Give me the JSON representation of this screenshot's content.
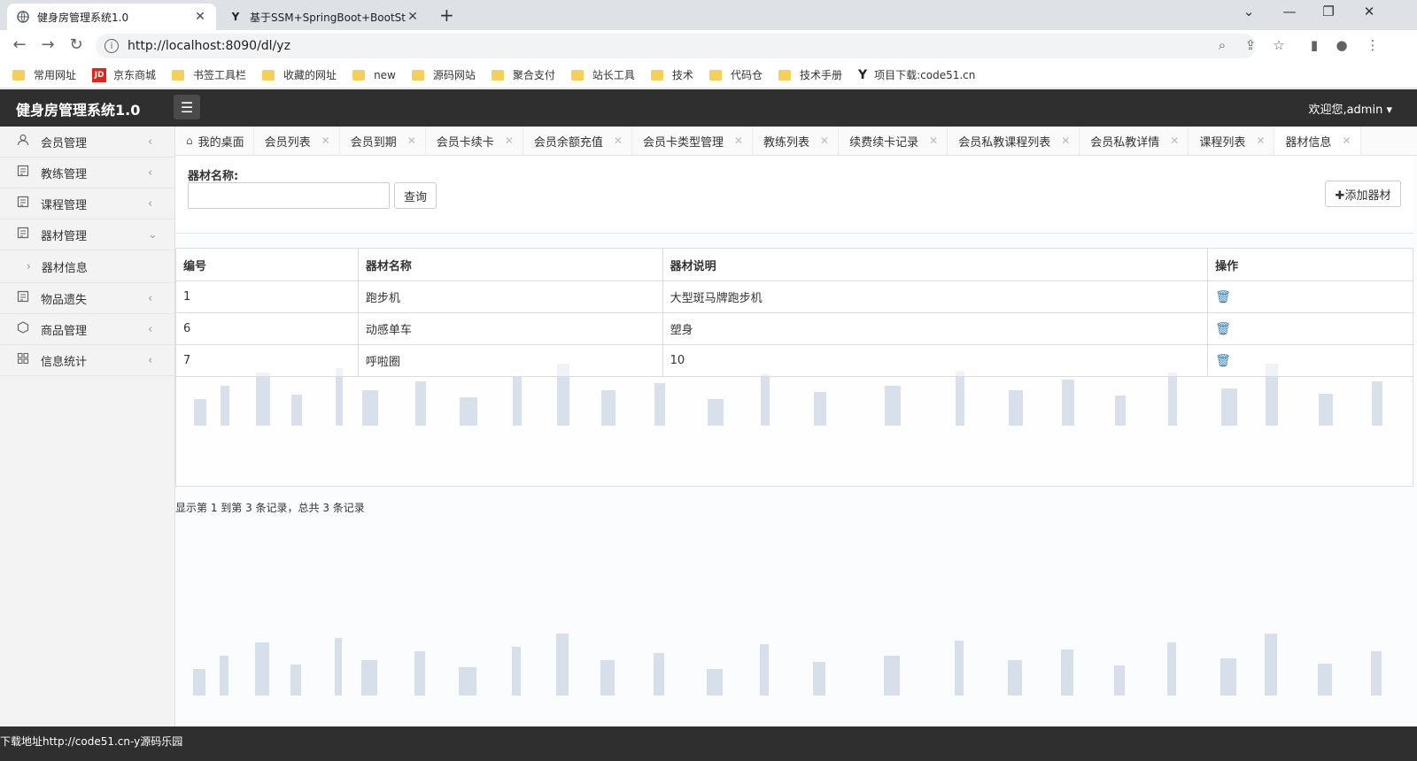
{
  "browser": {
    "tabs": [
      {
        "title": "健身房管理系统1.0",
        "active": true
      },
      {
        "title": "基于SSM+SpringBoot+BootSt",
        "active": false
      }
    ],
    "url": "http://localhost:8090/dl/yz",
    "bookmarks": [
      "常用网址",
      "京东商城",
      "书签工具栏",
      "收藏的网址",
      "new",
      "源码网站",
      "聚合支付",
      "站长工具",
      "技术",
      "代码仓",
      "技术手册",
      "项目下载:code51.cn"
    ]
  },
  "app": {
    "brand": "健身房管理系统1.0",
    "welcome": "欢迎您,admin"
  },
  "sidebar": {
    "items": [
      {
        "label": "会员管理",
        "icon": "user-icon"
      },
      {
        "label": "教练管理",
        "icon": "list-icon"
      },
      {
        "label": "课程管理",
        "icon": "list-icon"
      },
      {
        "label": "器材管理",
        "icon": "list-icon",
        "expanded": true
      },
      {
        "label": "器材信息",
        "sub": true
      },
      {
        "label": "物品遗失",
        "icon": "list-icon"
      },
      {
        "label": "商品管理",
        "icon": "cube-icon"
      },
      {
        "label": "信息统计",
        "icon": "grid-icon"
      }
    ]
  },
  "pagetabs": [
    "我的桌面",
    "会员列表",
    "会员到期",
    "会员卡续卡",
    "会员余额充值",
    "会员卡类型管理",
    "教练列表",
    "续费续卡记录",
    "会员私教课程列表",
    "会员私教详情",
    "课程列表",
    "器材信息"
  ],
  "search": {
    "label": "器材名称:",
    "value": "",
    "query_label": "查询",
    "add_label": "添加器材"
  },
  "table": {
    "headers": [
      "编号",
      "器材名称",
      "器材说明",
      "操作"
    ],
    "rows": [
      [
        "1",
        "跑步机",
        "大型斑马牌跑步机"
      ],
      [
        "6",
        "动感单车",
        "塑身"
      ],
      [
        "7",
        "呼啦圈",
        "10"
      ]
    ]
  },
  "pager": "显示第 1 到第 3 条记录，总共 3 条记录",
  "statusbar": "下载地址http://code51.cn-y源码乐园"
}
